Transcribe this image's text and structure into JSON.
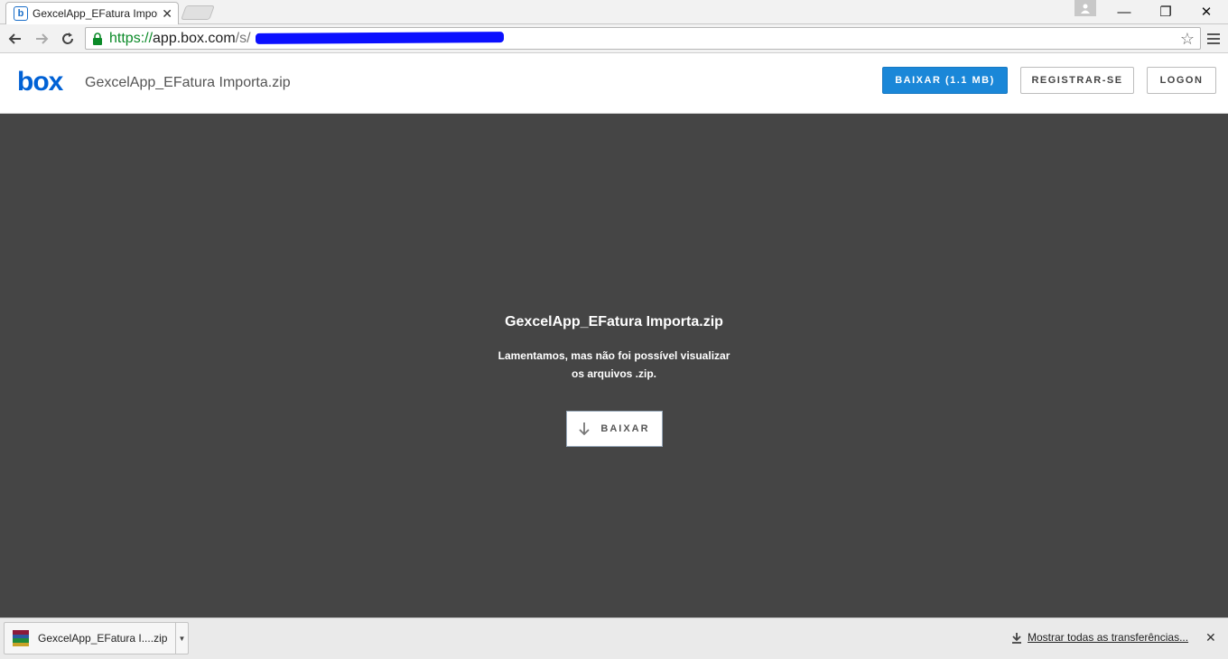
{
  "browser": {
    "tab_title": "GexcelApp_EFatura Import",
    "favicon_letter": "b",
    "url_scheme": "https://",
    "url_host": "app.box.com",
    "url_path": "/s/",
    "window_controls": {
      "minimize": "—",
      "maximize": "❐",
      "close": "✕"
    }
  },
  "header": {
    "logo_text": "box",
    "file_name": "GexcelApp_EFatura Importa.zip",
    "download_label": "BAIXAR  (1.1 MB)",
    "register_label": "REGISTRAR-SE",
    "logon_label": "LOGON"
  },
  "preview": {
    "title": "GexcelApp_EFatura Importa.zip",
    "message_line1": "Lamentamos, mas não foi possível visualizar",
    "message_line2": "os arquivos .zip.",
    "download_label": "BAIXAR"
  },
  "download_shelf": {
    "file_label": "GexcelApp_EFatura I....zip",
    "show_all_label": "Mostrar todas as transferências..."
  },
  "colors": {
    "brand": "#0061d5",
    "primary_button": "#1a87d8",
    "preview_bg": "#454545",
    "url_scheme": "#0b8a28"
  },
  "icons": [
    "back-arrow-icon",
    "forward-arrow-icon",
    "reload-icon",
    "lock-icon",
    "star-icon",
    "menu-icon",
    "download-arrow-icon",
    "winrar-archive-icon",
    "profile-icon"
  ]
}
